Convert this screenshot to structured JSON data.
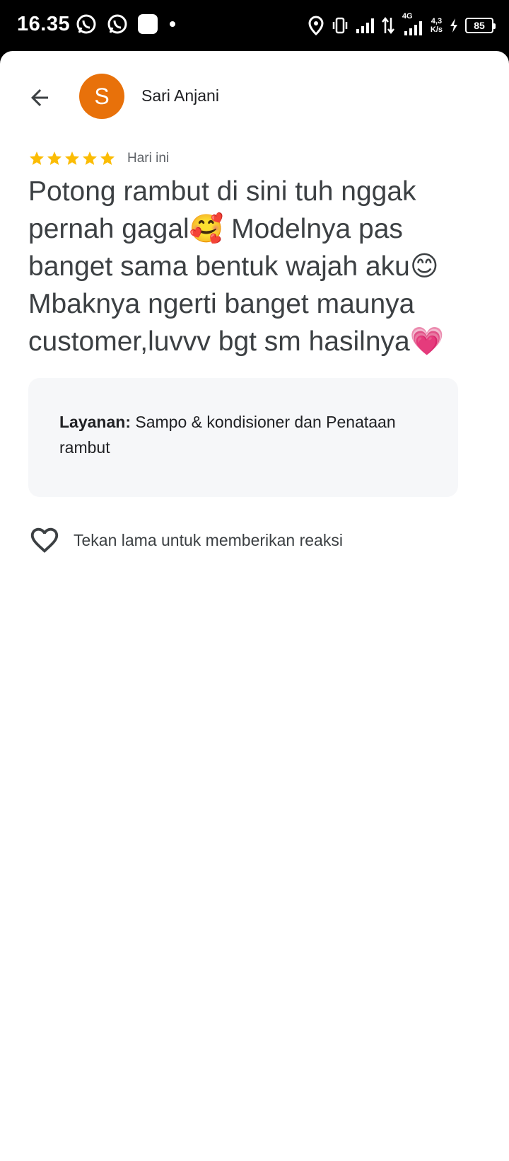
{
  "status_bar": {
    "time": "16.35",
    "network_type": "4G",
    "speed_value": "4,3",
    "speed_unit": "K/s",
    "battery": "85"
  },
  "header": {
    "avatar_initial": "S",
    "avatar_color": "#e8710a",
    "author_name": "Sari Anjani"
  },
  "review": {
    "rating": 5,
    "max_rating": 5,
    "date": "Hari ini",
    "text": "Potong rambut di sini tuh nggak pernah gagal🥰 Modelnya pas banget sama bentuk wajah aku😊 Mbaknya ngerti banget maunya customer,luvvv bgt sm hasilnya💗",
    "service_label": "Layanan:",
    "service_value": " Sampo & kondisioner dan Penataan rambut"
  },
  "reaction": {
    "icon": "heart-outline-icon",
    "text": "Tekan lama untuk memberikan reaksi"
  },
  "colors": {
    "star": "#fbbc04",
    "text_primary": "#3c4043",
    "service_bg": "#f6f7f9"
  }
}
